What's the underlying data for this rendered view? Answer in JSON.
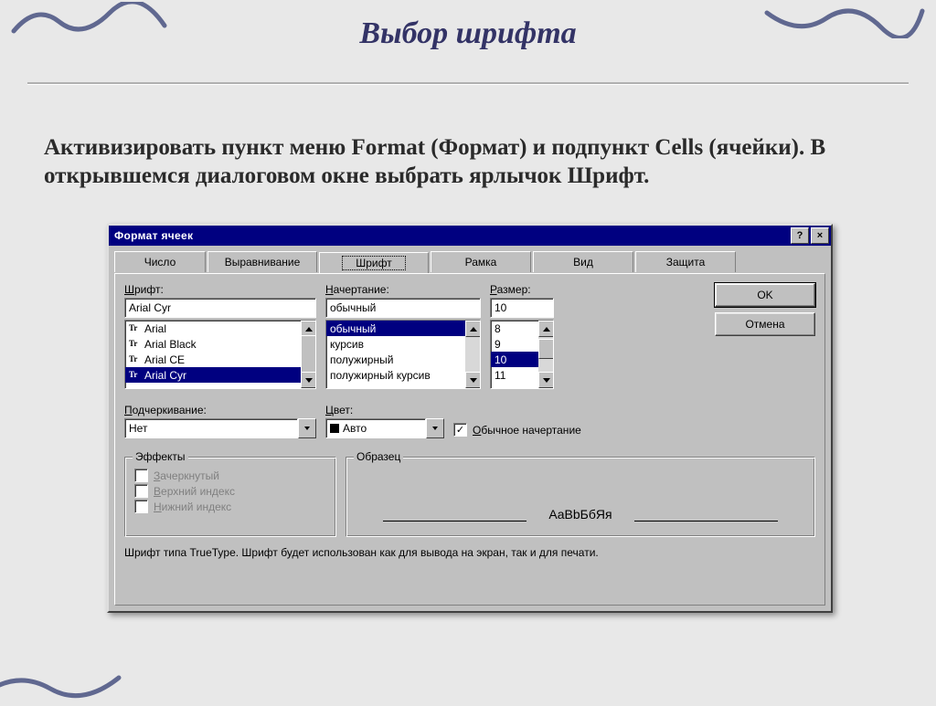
{
  "slide": {
    "title": "Выбор шрифта",
    "paragraph": "Активизировать пункт меню Format (Формат) и подпункт Cells (ячейки). В открывшемся диалоговом окне выбрать ярлычок Шрифт."
  },
  "dialog": {
    "title": "Формат ячеек",
    "help_char": "?",
    "close_char": "×",
    "tabs": {
      "number": "Число",
      "alignment": "Выравнивание",
      "font": "Шрифт",
      "border": "Рамка",
      "view": "Вид",
      "protection": "Защита"
    },
    "labels": {
      "font": "Шрифт:",
      "font_mn": "Ш",
      "style": "Начертание:",
      "style_mn": "Н",
      "size": "Размер:",
      "size_mn": "Р",
      "underline": "Подчеркивание:",
      "underline_mn": "П",
      "color": "Цвет:",
      "color_mn": "Ц",
      "normal_font": "бычное начертание",
      "normal_font_mn": "О",
      "effects": "Эффекты",
      "strike": "ачеркнутый",
      "strike_mn": "З",
      "super": "ерхний индекс",
      "super_mn": "В",
      "sub": "ижний индекс",
      "sub_mn": "Н",
      "sample": "Образец"
    },
    "font_value": "Arial Cyr",
    "font_list": [
      "Arial",
      "Arial Black",
      "Arial CE",
      "Arial Cyr"
    ],
    "font_selected": "Arial Cyr",
    "style_value": "обычный",
    "style_list": [
      "обычный",
      "курсив",
      "полужирный",
      "полужирный курсив"
    ],
    "style_selected": "обычный",
    "size_value": "10",
    "size_list": [
      "8",
      "9",
      "10",
      "11"
    ],
    "size_selected": "10",
    "underline_value": "Нет",
    "color_value": "Авто",
    "normal_checked": "✓",
    "buttons": {
      "ok": "OK",
      "cancel": "Отмена"
    },
    "sample_text": "AaBbБбЯя",
    "hint": "Шрифт типа TrueType. Шрифт будет использован как для вывода на экран, так и для печати."
  }
}
